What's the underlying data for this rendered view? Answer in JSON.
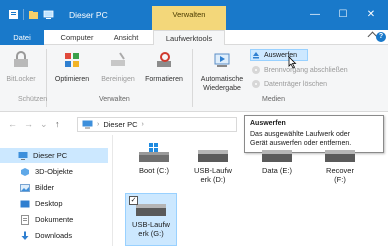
{
  "window": {
    "title": "Dieser PC",
    "context_tab_header": "Verwalten",
    "controls": {
      "minimize": "—",
      "maximize": "☐",
      "close": "✕"
    }
  },
  "ribbon_tabs": {
    "file": "Datei",
    "computer": "Computer",
    "view": "Ansicht",
    "drive_tools": "Laufwerktools",
    "help": "?"
  },
  "ribbon": {
    "bitlocker": "BitLocker",
    "optimize": "Optimieren",
    "cleanup": "Bereinigen",
    "format": "Formatieren",
    "autoplay": [
      "Automatische",
      "Wiedergabe"
    ],
    "eject": "Auswerfen",
    "finish_burning": "Brennvorgang abschließen",
    "erase_disc": "Datenträger löschen",
    "groups": {
      "protect": "Schützen",
      "manage": "Verwalten",
      "media": "Medien"
    }
  },
  "address": {
    "path": "Dieser PC"
  },
  "tooltip": {
    "title": "Auswerfen",
    "text": [
      "Das ausgewählte Laufwerk oder",
      "Gerät auswerfen oder entfernen."
    ]
  },
  "nav_pane": {
    "items": [
      "Dieser PC",
      "3D-Objekte",
      "Bilder",
      "Desktop",
      "Dokumente",
      "Downloads"
    ]
  },
  "drives": [
    [
      "Boot (C:)"
    ],
    [
      "USB-Laufw",
      "erk (D:)"
    ],
    [
      "Data (E:)"
    ],
    [
      "Recover",
      "(F:)"
    ],
    [
      "USB-Laufw",
      "erk (G:)"
    ]
  ],
  "checkbox_mark": "✓",
  "colors": {
    "accent": "#1979ca",
    "context_tab": "#f3d77a",
    "selection": "#cce8ff"
  }
}
